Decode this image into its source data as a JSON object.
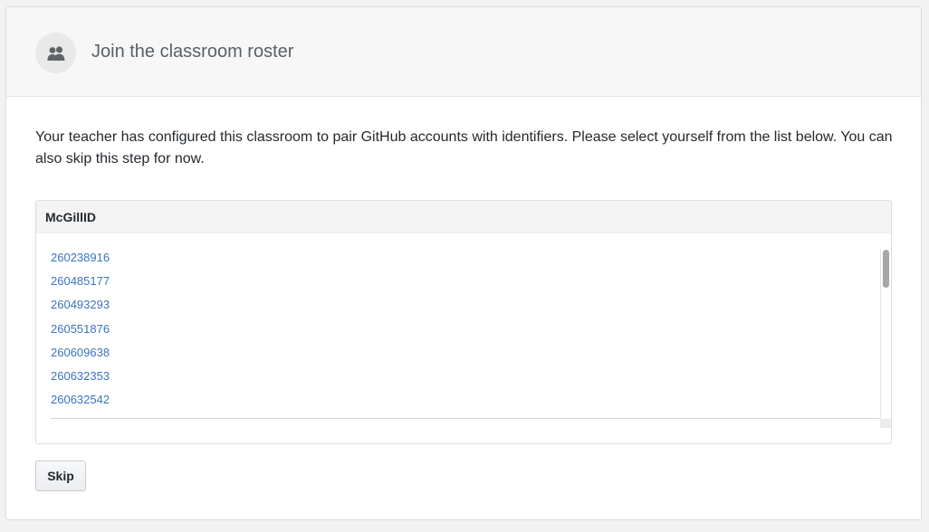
{
  "header": {
    "icon": "people-icon",
    "title": "Join the classroom roster"
  },
  "body": {
    "instructions": "Your teacher has configured this classroom to pair GitHub accounts with identifiers. Please select yourself from the list below. You can also skip this step for now."
  },
  "roster": {
    "column_header": "McGillID",
    "entries": [
      "260238916",
      "260485177",
      "260493293",
      "260551876",
      "260609638",
      "260632353",
      "260632542"
    ]
  },
  "actions": {
    "skip_label": "Skip"
  },
  "colors": {
    "link": "#3b73c0",
    "header_bg": "#f7f7f7",
    "title_text": "#586069"
  }
}
